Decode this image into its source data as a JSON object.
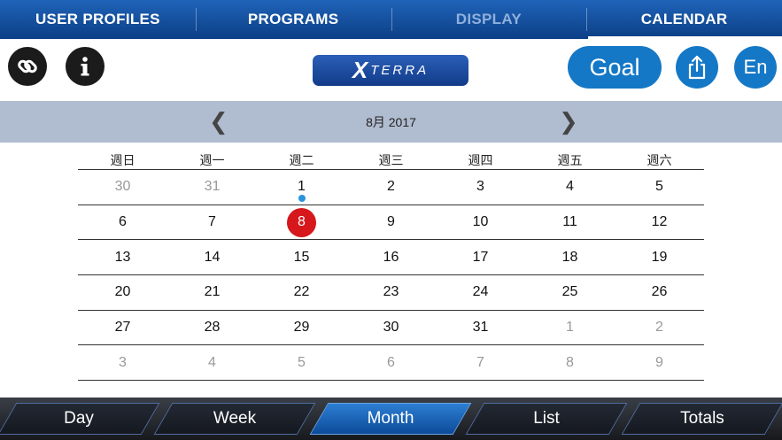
{
  "top_tabs": [
    "USER PROFILES",
    "PROGRAMS",
    "DISPLAY",
    "CALENDAR"
  ],
  "toolbar": {
    "link_icon": "link-icon",
    "info_icon": "info-icon",
    "logo_mark": "X",
    "logo_text": "TERRA",
    "goal_label": "Goal",
    "share_icon": "share-icon",
    "lang_label": "En"
  },
  "calendar": {
    "month_label": "8月 2017",
    "prev_arrow": "❮",
    "next_arrow": "❯",
    "weekdays": [
      "週日",
      "週一",
      "週二",
      "週三",
      "週四",
      "週五",
      "週六"
    ],
    "weeks": [
      [
        "30",
        "31",
        "1",
        "2",
        "3",
        "4",
        "5"
      ],
      [
        "6",
        "7",
        "8",
        "9",
        "10",
        "11",
        "12"
      ],
      [
        "13",
        "14",
        "15",
        "16",
        "17",
        "18",
        "19"
      ],
      [
        "20",
        "21",
        "22",
        "23",
        "24",
        "25",
        "26"
      ],
      [
        "27",
        "28",
        "29",
        "30",
        "31",
        "1",
        "2"
      ],
      [
        "3",
        "4",
        "5",
        "6",
        "7",
        "8",
        "9"
      ]
    ],
    "today": "8",
    "event_day": "1"
  },
  "bottom_tabs": [
    "Day",
    "Week",
    "Month",
    "List",
    "Totals"
  ],
  "colors": {
    "accent": "#1478c6",
    "today": "#d6171c",
    "event_dot": "#2a93dc",
    "month_bar": "#b0bccf"
  }
}
